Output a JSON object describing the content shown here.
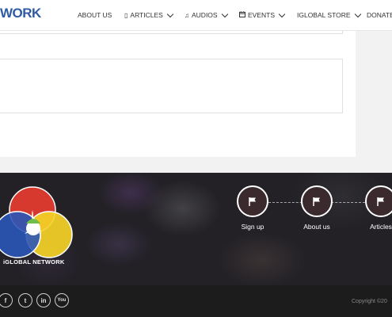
{
  "header": {
    "logo_text": "WORK",
    "nav": [
      {
        "label": "ABOUT US",
        "icon": "",
        "dropdown": false
      },
      {
        "label": "ARTICLES",
        "icon": "document-icon",
        "dropdown": true
      },
      {
        "label": "AUDIOS",
        "icon": "music-note-icon",
        "dropdown": true
      },
      {
        "label": "EVENTS",
        "icon": "calendar-icon",
        "dropdown": true
      },
      {
        "label": "IGLOBAL STORE",
        "icon": "",
        "dropdown": true
      },
      {
        "label": "DONATE",
        "icon": "",
        "dropdown": false
      }
    ]
  },
  "footer": {
    "brand_name": "iGLOBAL NETWORK",
    "logo_colors": [
      "#e23b2e",
      "#f5d327",
      "#2b57b8",
      "#ffffff"
    ],
    "steps": [
      {
        "label": "Sign up",
        "icon": "flag-icon"
      },
      {
        "label": "About us",
        "icon": "flag-icon"
      },
      {
        "label": "Articles",
        "icon": "flag-icon"
      }
    ],
    "social": [
      {
        "name": "facebook-icon",
        "glyph": "f"
      },
      {
        "name": "twitter-icon",
        "glyph": "t"
      },
      {
        "name": "linkedin-icon",
        "glyph": "in"
      },
      {
        "name": "youtube-icon",
        "glyph": "You"
      }
    ],
    "copyright": "Copyright ©20"
  }
}
